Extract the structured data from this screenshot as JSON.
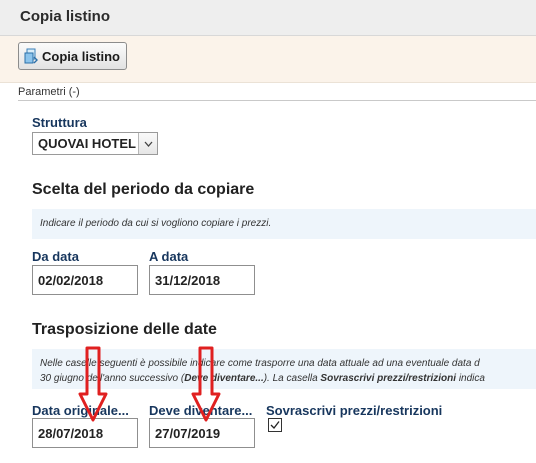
{
  "window": {
    "title": "Copia listino"
  },
  "toolbar": {
    "copy_button_label": "Copia listino",
    "copy_button_icon": "copy-price-list-icon"
  },
  "section": {
    "legend": "Parametri (-)"
  },
  "struttura": {
    "label": "Struttura",
    "selected": "QUOVAI HOTEL"
  },
  "periodo": {
    "heading": "Scelta del periodo da copiare",
    "info": "Indicare il periodo da cui si vogliono copiare i prezzi.",
    "from_label": "Da data",
    "from_value": "02/02/2018",
    "to_label": "A data",
    "to_value": "31/12/2018"
  },
  "trasposizione": {
    "heading": "Trasposizione delle date",
    "info_line1": "Nelle caselle seguenti è possibile indicare come trasporre una data attuale ad una eventuale data d",
    "info_line2_a": "30 giugno dell'anno successivo (",
    "info_line2_b": "Deve diventare...",
    "info_line2_c": "). La casella ",
    "info_line2_d": "Sovrascrivi prezzi/restrizioni",
    "info_line2_e": " indica",
    "original_label": "Data originale...",
    "original_value": "28/07/2018",
    "becomes_label": "Deve diventare...",
    "becomes_value": "27/07/2019",
    "overwrite_label": "Sovrascrivi prezzi/restrizioni",
    "overwrite_checked": true
  },
  "colors": {
    "annotation_arrow": "#e02020",
    "label_blue": "#17365d"
  }
}
